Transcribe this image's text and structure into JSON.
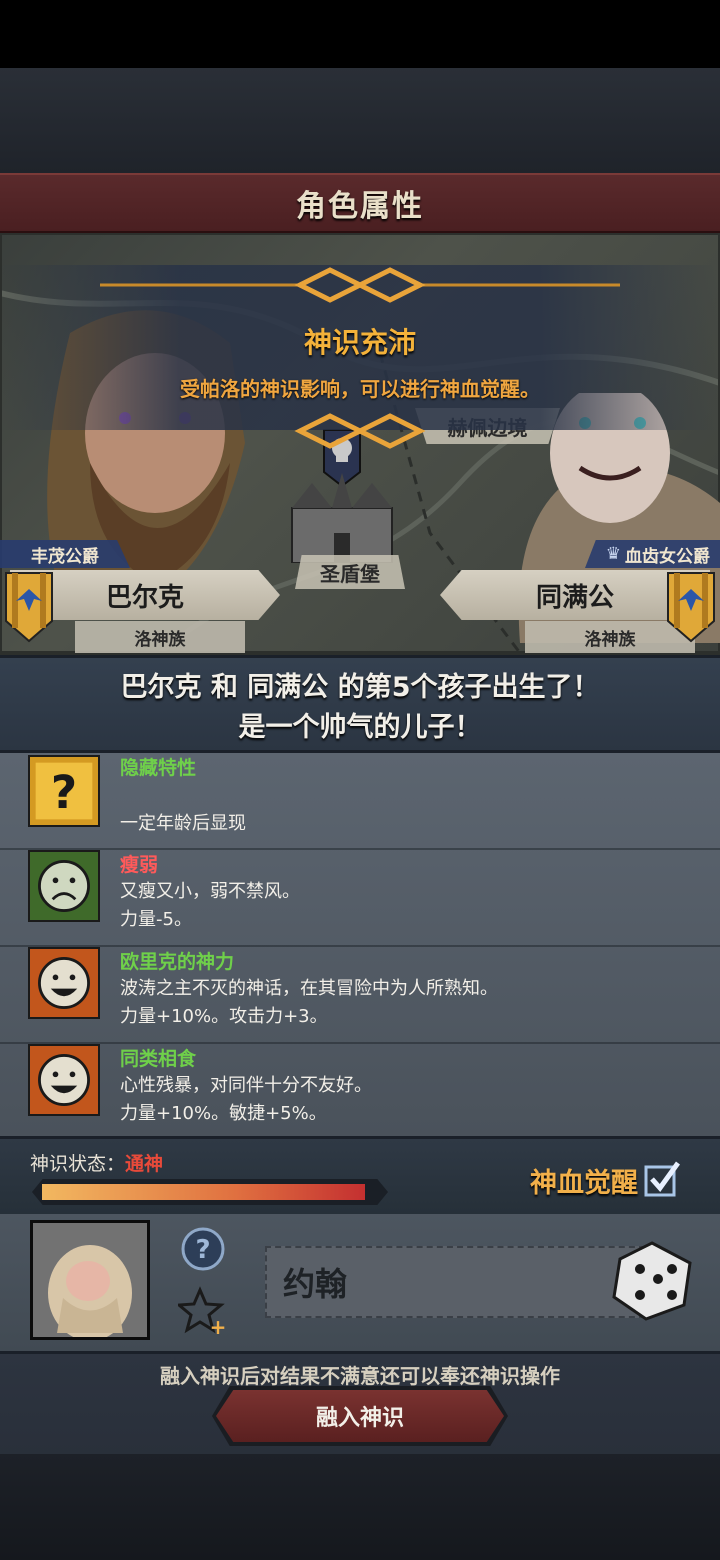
{
  "window": {
    "title": "角色属性"
  },
  "banner": {
    "title": "神识充沛",
    "subtitle": "受帕洛的神识影响，可以进行神血觉醒。"
  },
  "map": {
    "place_border": "赫佩边境",
    "place_castle": "圣盾堡"
  },
  "parents": {
    "father": {
      "title": "丰茂公爵",
      "name": "巴尔克",
      "tribe": "洛神族"
    },
    "mother": {
      "title": "血齿女公爵",
      "name": "同满公",
      "tribe": "洛神族"
    }
  },
  "announcement": {
    "line1": "巴尔克 和 同满公 的第5个孩子出生了！",
    "line2": "是一个帅气的儿子！"
  },
  "traits": [
    {
      "name": "隐藏特性",
      "name_color": "#6fd04a",
      "icon": "question-icon",
      "line1": "",
      "line2": "一定年龄后显现"
    },
    {
      "name": "瘦弱",
      "name_color": "#ff5a5a",
      "icon": "sad-face-icon",
      "line1": "又瘦又小，弱不禁风。",
      "line2": "力量-5。"
    },
    {
      "name": "欧里克的神力",
      "name_color": "#6fd04a",
      "icon": "smile-face-icon",
      "line1": "波涛之主不灭的神话，在其冒险中为人所熟知。",
      "line2": "力量+10%。攻击力+3。"
    },
    {
      "name": "同类相食",
      "name_color": "#6fd04a",
      "icon": "smile-face-icon",
      "line1": "心性残暴，对同伴十分不友好。",
      "line2": "力量+10%。敏捷+5%。"
    }
  ],
  "status": {
    "label": "神识状态：",
    "value": "通神",
    "progress": 0.96,
    "awaken_label": "神血觉醒",
    "awaken_checked": true
  },
  "child": {
    "name": "约翰"
  },
  "footer": {
    "hint": "融入神识后对结果不满意还可以奉还神识操作",
    "merge_label": "融入神识"
  },
  "colors": {
    "accent_gold": "#f2b04a",
    "bad_red": "#ff5a5a",
    "good_green": "#6fd04a"
  }
}
